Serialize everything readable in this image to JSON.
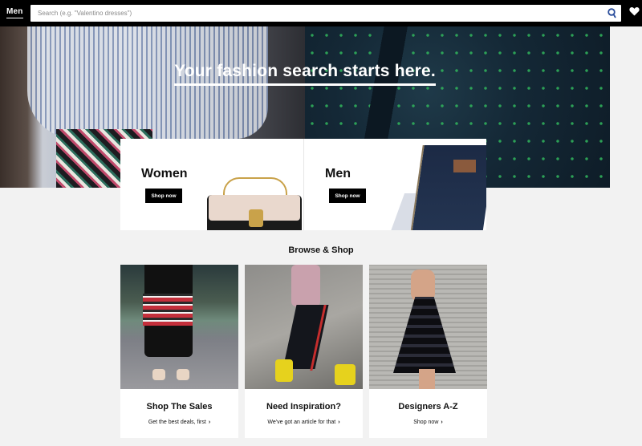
{
  "topbar": {
    "nav_label": "Men",
    "search_placeholder": "Search (e.g. \"Valentino dresses\")"
  },
  "hero": {
    "title": "Your fashion search starts here."
  },
  "categories": [
    {
      "title": "Women",
      "button": "Shop now"
    },
    {
      "title": "Men",
      "button": "Shop now"
    }
  ],
  "browse": {
    "title": "Browse & Shop",
    "tiles": [
      {
        "title": "Shop The Sales",
        "link": "Get the best deals, first"
      },
      {
        "title": "Need Inspiration?",
        "link": "We've got an article for that"
      },
      {
        "title": "Designers A-Z",
        "link": "Shop now"
      }
    ]
  },
  "icons": {
    "search": "search-icon",
    "heart": "heart-icon",
    "chevron": "chevron-right-icon"
  },
  "colors": {
    "topbar": "#000000",
    "search_icon": "#2a4d9b",
    "page_bg": "#f2f2f2"
  }
}
